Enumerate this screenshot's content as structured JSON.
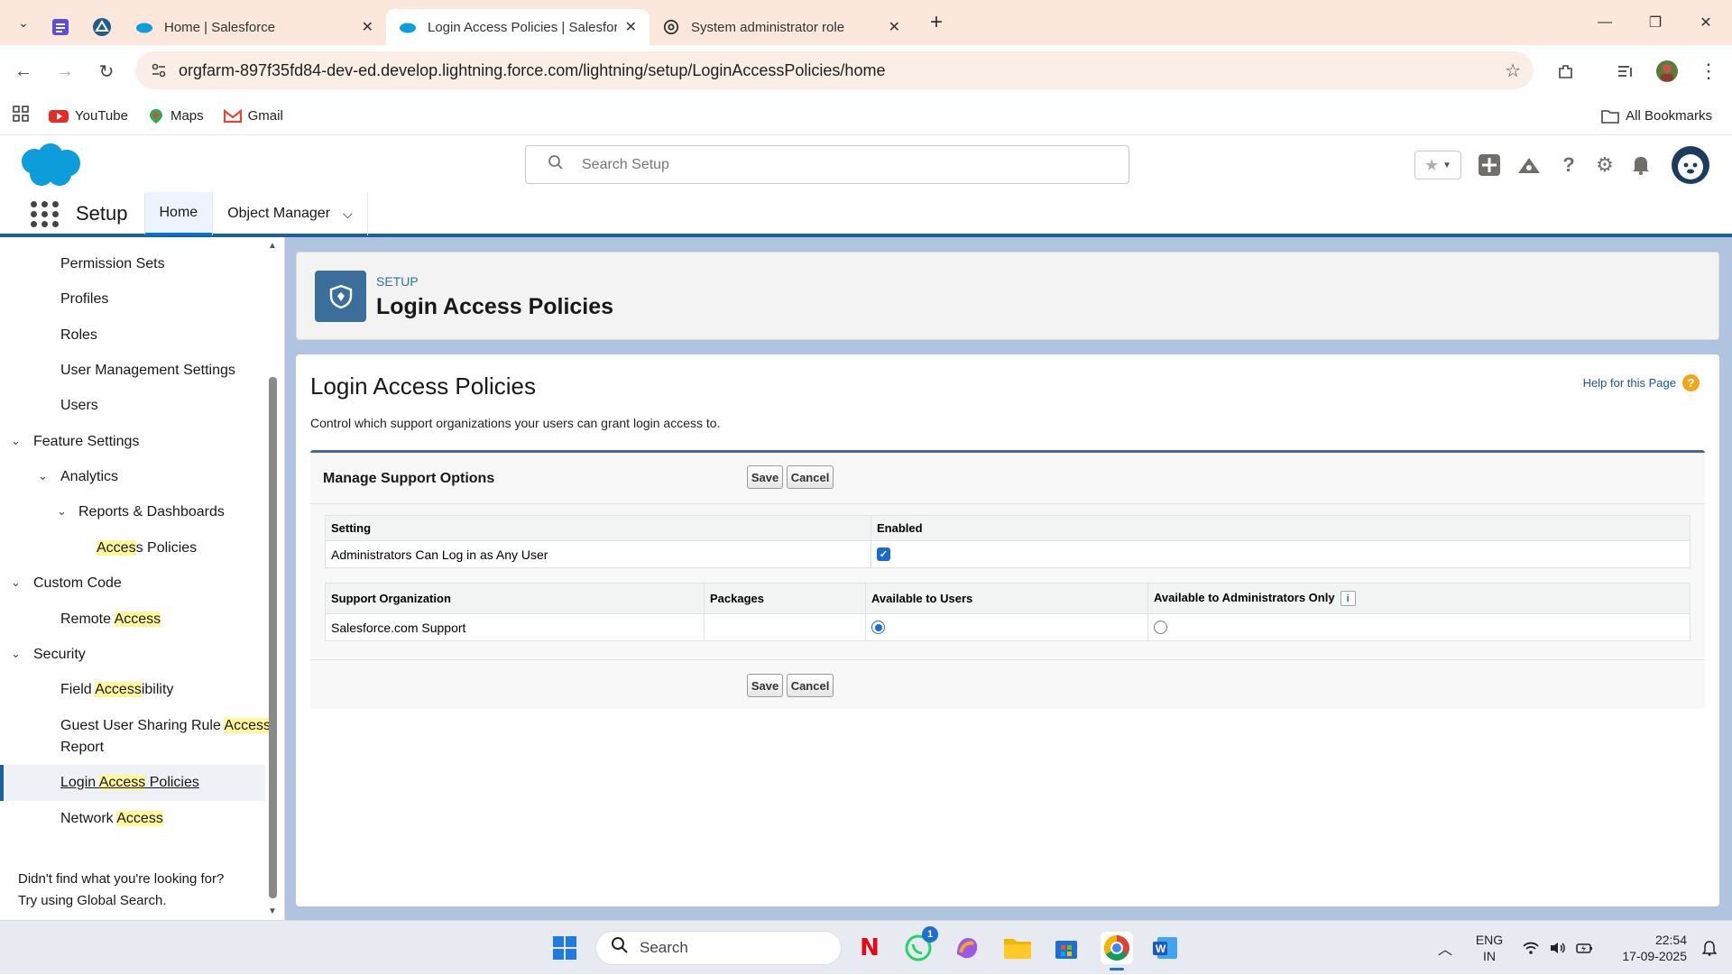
{
  "browser": {
    "tabs": [
      {
        "title": "Home | Salesforce",
        "active": false
      },
      {
        "title": "Login Access Policies | Salesforc",
        "active": true
      },
      {
        "title": "System administrator role",
        "active": false
      }
    ],
    "url": "orgfarm-897f35fd84-dev-ed.develop.lightning.force.com/lightning/setup/LoginAccessPolicies/home",
    "bookmarks": [
      "YouTube",
      "Maps",
      "Gmail"
    ],
    "all_bookmarks": "All Bookmarks"
  },
  "header": {
    "search_placeholder": "Search Setup"
  },
  "nav": {
    "app_name": "Setup",
    "tabs": [
      {
        "label": "Home"
      },
      {
        "label": "Object Manager"
      }
    ]
  },
  "sidebar": {
    "items": [
      {
        "label": "Permission Sets"
      },
      {
        "label": "Profiles"
      },
      {
        "label": "Roles"
      },
      {
        "label": "User Management Settings"
      },
      {
        "label": "Users"
      },
      {
        "label": "Feature Settings"
      },
      {
        "label": "Analytics"
      },
      {
        "label": "Reports & Dashboards"
      },
      {
        "pre": "",
        "hl": "Acces",
        "post": "s Policies"
      },
      {
        "label": "Custom Code"
      },
      {
        "pre": "Remote ",
        "hl": "Access",
        "post": ""
      },
      {
        "label": "Security"
      },
      {
        "pre": "Field ",
        "hl": "Access",
        "post": "ibility"
      },
      {
        "pre": "Guest User Sharing Rule ",
        "hl": "Access",
        "post": "",
        "line2": "Report"
      },
      {
        "pre": "Login ",
        "hl": "Access",
        "post": " Policies"
      },
      {
        "pre": "Network ",
        "hl": "Access",
        "post": ""
      }
    ],
    "footer_line1": "Didn't find what you're looking for?",
    "footer_line2": "Try using Global Search."
  },
  "page_header": {
    "eyebrow": "SETUP",
    "title": "Login Access Policies"
  },
  "content": {
    "title": "Login Access Policies",
    "help_link": "Help for this Page",
    "description": "Control which support organizations your users can grant login access to.",
    "block_title": "Manage Support Options",
    "save_label": "Save",
    "cancel_label": "Cancel",
    "settings_table": {
      "headers": [
        "Setting",
        "Enabled"
      ],
      "rows": [
        {
          "setting": "Administrators Can Log in as Any User",
          "enabled": true
        }
      ]
    },
    "support_table": {
      "headers": [
        "Support Organization",
        "Packages",
        "Available to Users",
        "Available to Administrators Only"
      ],
      "rows": [
        {
          "org": "Salesforce.com Support",
          "packages": "",
          "available_to_users": true,
          "admins_only": false
        }
      ]
    }
  },
  "taskbar": {
    "search_label": "Search",
    "whatsapp_badge": "1",
    "lang": "ENG",
    "region": "IN",
    "time": "22:54",
    "date": "17-09-2025"
  },
  "colors": {
    "accent": "#1b5f9e",
    "brand": "#00a1e0",
    "highlight": "#fff79a"
  }
}
